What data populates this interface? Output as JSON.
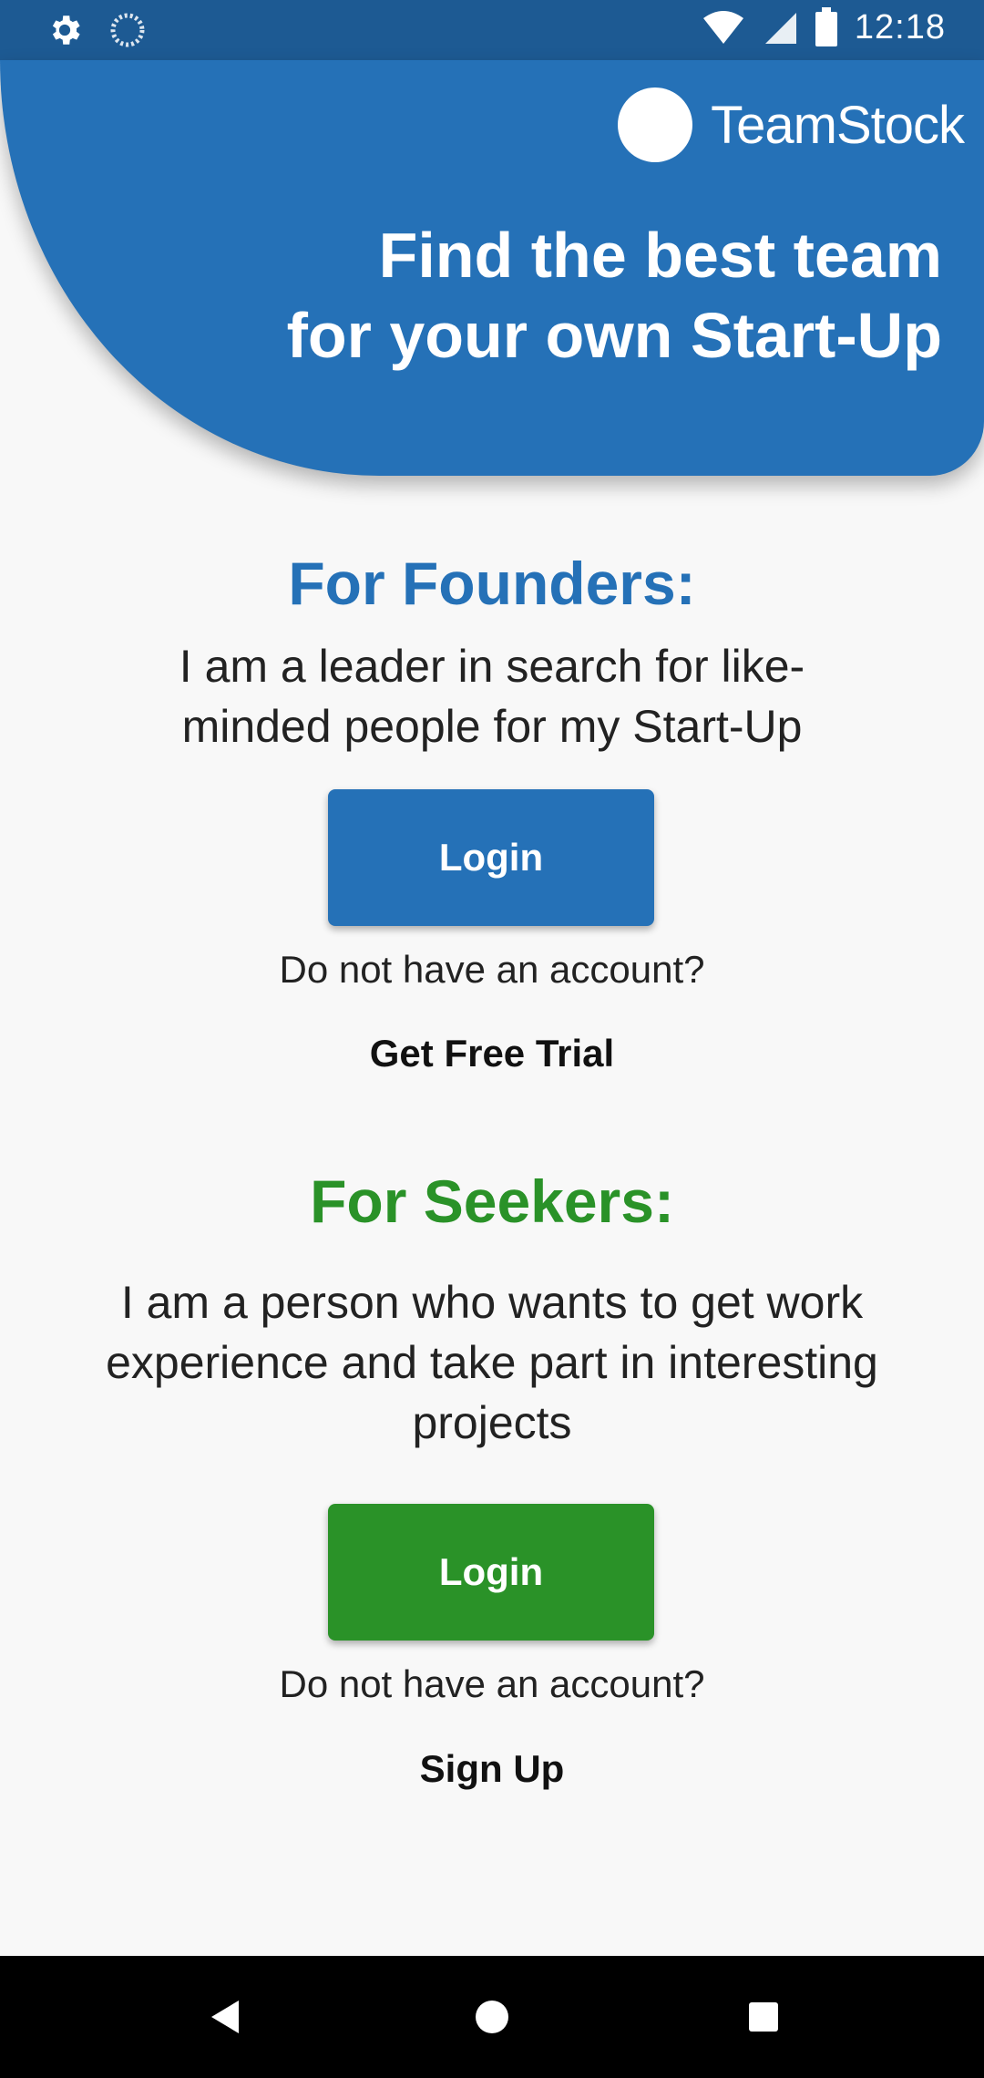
{
  "status_bar": {
    "time": "12:18",
    "left_icons": [
      "settings-icon",
      "loading-icon"
    ],
    "right_icons": [
      "wifi-icon",
      "signal-icon",
      "battery-icon"
    ]
  },
  "header": {
    "app_name": "TeamStock",
    "tagline_line1": "Find the best team",
    "tagline_line2": "for your own Start-Up",
    "color": "#2571b7"
  },
  "founders": {
    "title": "For Founders:",
    "description_line1": "I am a leader in search for like-",
    "description_line2": "minded people for my Start-Up",
    "login_label": "Login",
    "no_account_text": "Do not have an account?",
    "cta_label": "Get Free Trial",
    "color": "#2571b7"
  },
  "seekers": {
    "title": "For Seekers:",
    "description_line1": "I am a person who wants to get work",
    "description_line2": "experience and take part in interesting",
    "description_line3": "projects",
    "login_label": "Login",
    "no_account_text": "Do not have an account?",
    "cta_label": "Sign Up",
    "color": "#2a9228"
  },
  "nav_bar": {
    "buttons": [
      "back-icon",
      "home-icon",
      "recents-icon"
    ]
  }
}
